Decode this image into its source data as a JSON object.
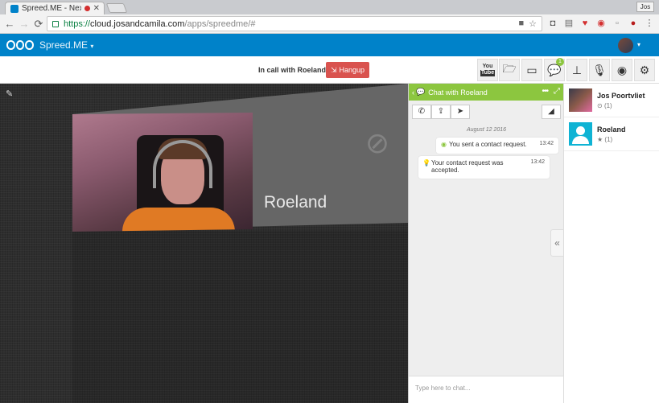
{
  "browser": {
    "tab_title": "Spreed.ME - Nextclo",
    "tab_close": "✕",
    "profile_label": "Jos",
    "url_scheme": "https://",
    "url_host": "cloud.josandcamila.com",
    "url_path": "/apps/spreedme/#"
  },
  "header": {
    "app_name": "Spreed.ME",
    "app_caret": "▾",
    "user_caret": "▾"
  },
  "toolbar": {
    "call_status": "In call with Roeland",
    "hangup_label": "Hangup",
    "youtube_label_top": "You",
    "youtube_label_bottom": "Tube",
    "chat_badge": "1"
  },
  "video": {
    "peer_name": "Roeland"
  },
  "chat": {
    "title": "Chat with Roeland",
    "date": "August 12 2016",
    "messages": [
      {
        "text": "You sent a contact request.",
        "time": "13:42"
      },
      {
        "text": "Your contact request was accepted.",
        "time": "13:42"
      }
    ],
    "input_placeholder": "Type here to chat..."
  },
  "buddies": [
    {
      "name": "Jos Poortvliet",
      "sessions": "(1)"
    },
    {
      "name": "Roeland",
      "sessions": "(1)"
    }
  ],
  "colors": {
    "nextcloud_blue": "#0082c9",
    "chat_green": "#8cc63f",
    "hangup_red": "#d9534f"
  }
}
